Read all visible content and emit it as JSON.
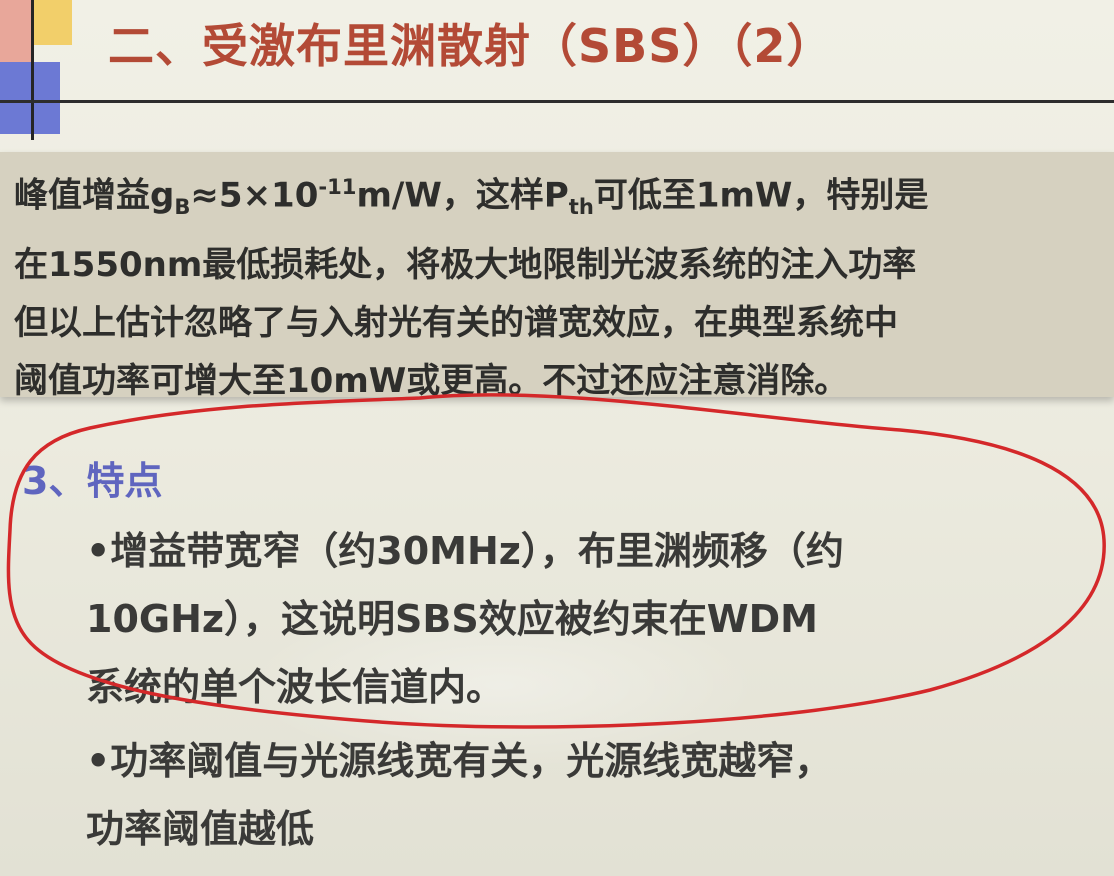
{
  "slide": {
    "title": "二、受激布里渊散射（SBS）（2）",
    "paragraph": {
      "line1": {
        "a": "峰值增益g",
        "sub_b": "B",
        "b": "≈5×10",
        "sup_exp": "-11",
        "c": "m/W，这样P",
        "sub_th": "th",
        "d": "可低至1mW，特别是"
      },
      "line2": "在1550nm最低损耗处，将极大地限制光波系统的注入功率",
      "line3": "但以上估计忽略了与入射光有关的谱宽效应，在典型系统中",
      "line4": "阈值功率可增大至10mW或更高。不过还应注意消除。"
    },
    "section": {
      "heading": "3、特点",
      "bullet1": {
        "line1": "•增益带宽窄（约30MHz），布里渊频移（约",
        "line2": "10GHz），这说明SBS效应被约束在WDM",
        "line3": "系统的单个波长信道内。"
      },
      "bullet2": {
        "line1": "•功率阈值与光源线宽有关，光源线宽越窄，",
        "line2": "功率阈值越低"
      }
    },
    "colors": {
      "title": "#b34a36",
      "heading": "#5f65bf",
      "body_text": "#3a3a38",
      "annotation_circle": "#d4282a",
      "box_background": "#d6d1c0",
      "deco_red": "#e8a79a",
      "deco_yellow": "#f2cf6a",
      "deco_blue": "#6c79d4"
    }
  }
}
